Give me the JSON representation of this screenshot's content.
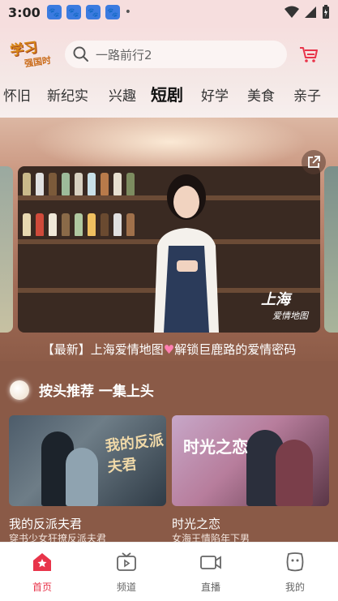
{
  "status_bar": {
    "time": "3:00",
    "dot": "•"
  },
  "header": {
    "logo_text": "学习",
    "logo_sub": "强国时",
    "search_placeholder": "一路前行2",
    "tabs": [
      "怀旧",
      "新纪实",
      "兴趣",
      "短剧",
      "好学",
      "美食",
      "亲子"
    ],
    "active_tab": "短剧"
  },
  "banner": {
    "watermark_big": "上海",
    "watermark_small": "爱情地图",
    "caption_prefix": "【最新】上海爱情地图",
    "caption_suffix": "解锁巨鹿路的爱情密码"
  },
  "section": {
    "title": "按头推荐 一集上头"
  },
  "videos": [
    {
      "title": "我的反派夫君",
      "subtitle": "穿书少女狂撩反派夫君",
      "art": "我的反派夫君"
    },
    {
      "title": "时光之恋",
      "subtitle": "女海王情陷年下男",
      "art": "时光之恋"
    }
  ],
  "bottom_nav": [
    {
      "label": "首页",
      "active": true
    },
    {
      "label": "频道",
      "active": false
    },
    {
      "label": "直播",
      "active": false
    },
    {
      "label": "我的",
      "active": false
    }
  ],
  "colors": {
    "accent": "#e8344a",
    "background": "#8a5a47"
  }
}
